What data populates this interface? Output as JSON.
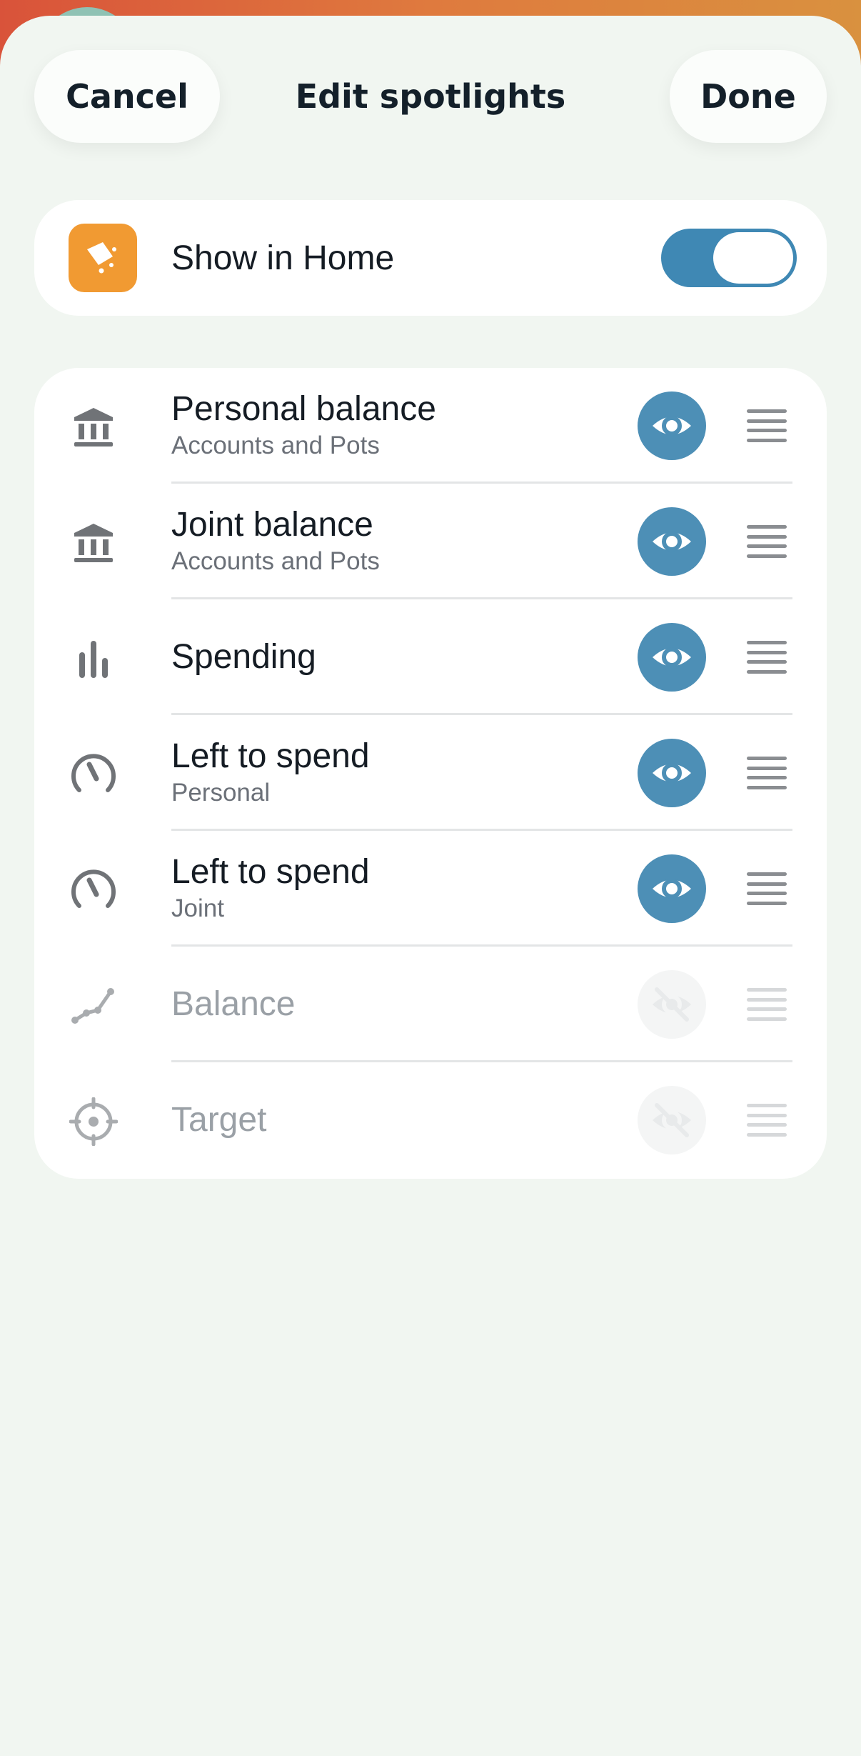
{
  "header": {
    "cancel_label": "Cancel",
    "title": "Edit spotlights",
    "done_label": "Done"
  },
  "show_in_home": {
    "label": "Show in Home",
    "enabled": true
  },
  "spotlights": [
    {
      "title": "Personal balance",
      "subtitle": "Accounts and Pots",
      "icon": "bank-icon",
      "visible": true
    },
    {
      "title": "Joint balance",
      "subtitle": "Accounts and Pots",
      "icon": "bank-icon",
      "visible": true
    },
    {
      "title": "Spending",
      "subtitle": "",
      "icon": "bar-chart-icon",
      "visible": true
    },
    {
      "title": "Left to spend",
      "subtitle": "Personal",
      "icon": "gauge-icon",
      "visible": true
    },
    {
      "title": "Left to spend",
      "subtitle": "Joint",
      "icon": "gauge-icon",
      "visible": true
    },
    {
      "title": "Balance",
      "subtitle": "",
      "icon": "line-graph-icon",
      "visible": false
    },
    {
      "title": "Target",
      "subtitle": "",
      "icon": "target-icon",
      "visible": false
    }
  ],
  "colors": {
    "accent": "#4d8fb6",
    "toggle": "#3f88b4",
    "app_icon": "#f19a32"
  }
}
